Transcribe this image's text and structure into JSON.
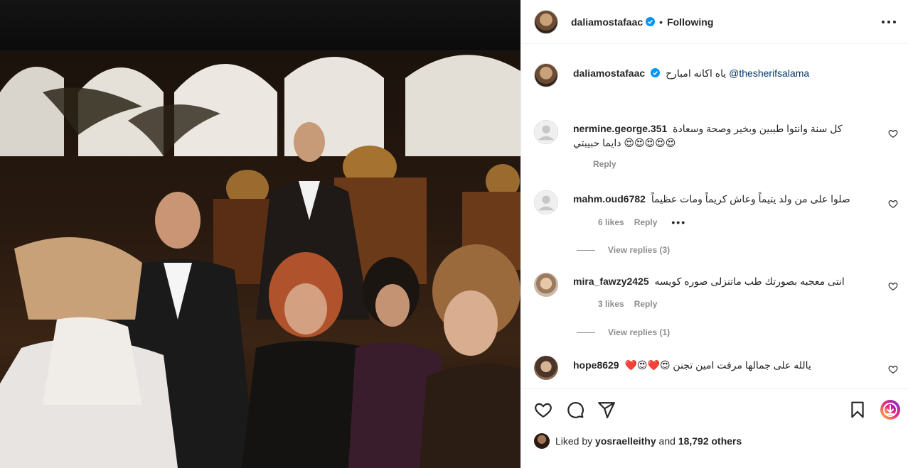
{
  "post": {
    "author": "daliamostafaac",
    "follow_status": "Following",
    "dot": "•",
    "caption_mention": "@thesherifsalama",
    "caption_text": "ياه اكانه امبارح"
  },
  "comments": [
    {
      "user": "nermine.george.351",
      "text_line1": "كل سنة وانتوا طيبين وبخير وصحة وسعادة",
      "text_line2": "😍😍😍😍😍 دايما حبيبتي",
      "reply_label": "Reply"
    },
    {
      "user": "mahm.oud6782",
      "text_line1": "صلوا على من ولد يتيماً وعاش كريماً ومات عظيماً",
      "likes": "6 likes",
      "reply_label": "Reply",
      "more": "•••",
      "view_replies": "View replies (3)"
    },
    {
      "user": "mira_fawzy2425",
      "text_line1": "انتى معجبه بصورتك طب ماتنزلى صوره كويسه",
      "likes": "3 likes",
      "reply_label": "Reply",
      "view_replies": "View replies (1)"
    },
    {
      "user": "hope8629",
      "text_line1": "يالله على جمالها مرفت امين تجنن 😍❤️😍❤️"
    }
  ],
  "likes": {
    "prefix": "Liked by",
    "user": "yosraelleithy",
    "middle": "and",
    "count": "18,792 others"
  },
  "icons": [
    "verified-badge-icon",
    "more-options-icon",
    "heart-icon",
    "comment-icon",
    "share-icon",
    "bookmark-icon",
    "download-icon",
    "default-avatar-icon"
  ],
  "colors": {
    "verified": "#0095f6",
    "text": "#262626",
    "muted": "#8e8e8e",
    "download_gradient": [
      "#f9ce34",
      "#ee2a7b",
      "#6228d7"
    ]
  }
}
